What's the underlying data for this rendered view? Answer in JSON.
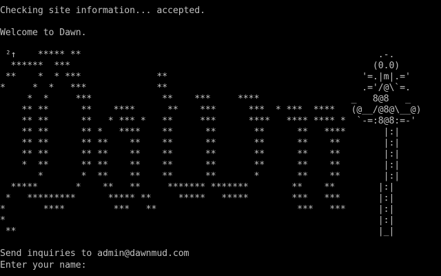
{
  "colors": {
    "background": "#000000",
    "text": "#c0c0c0"
  },
  "terminal": {
    "status_line": "Checking site information... accepted.",
    "blank_1": "",
    "welcome_line": "Welcome to Dawn.",
    "blank_2": "",
    "banner_lines": [
      " ²↑    ***** **                                                       .-.",
      "  ******  ***                                                        (0.0)",
      " **    *  * ***              **                                    '=.|m|.='",
      "*     *  *   ***             **                                    .='/@\\`=.",
      "     *  *     ***             **    ***     ****                 _   8@8   _",
      "    ** **      **    ****      **    ***      ***  * ***  ****   (@__/@8@\\__@)",
      "    ** **      **   * *** *   **     ***      ****   **** **** *  `-=:8@8:=-'",
      "    ** **      ** *   ****    **      **       **      **   ****       |:|",
      "    ** **      ** **    **    **      **       **      **    **        |:|",
      "    ** **      ** **    **    **      **       **      **    **        |:|",
      "    *  **      ** **    **    **      **       **      **    **        |:|",
      "       *       *  **    **    **      **       *       **    **        |:|",
      "  *****       *    **   **     ******* *******        **    **        |:|",
      " *   *********      ***** **     *****   *****        ***   ***       |:|",
      "*       ****         ***   **                          ***   ***      |:|",
      "*                                                                     |:|",
      " **                                                                   |_|"
    ],
    "blank_3": "",
    "inquiries_line": "Send inquiries to admin@dawnmud.com",
    "prompt_line": "Enter your name: "
  }
}
